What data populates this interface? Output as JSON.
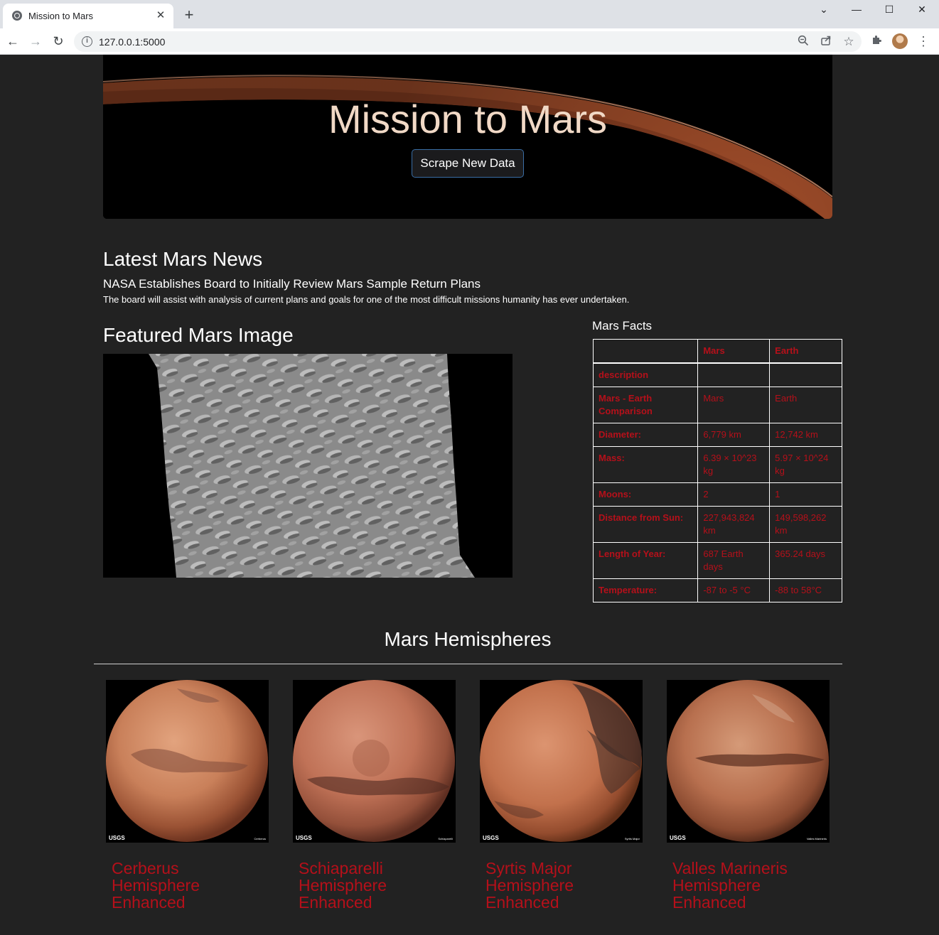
{
  "browser": {
    "tab_title": "Mission to Mars",
    "tab_close": "✕",
    "new_tab": "+",
    "url": "127.0.0.1:5000",
    "window_controls": {
      "tab_search": "⌄",
      "minimize": "—",
      "maximize": "☐",
      "close": "✕"
    },
    "icons": [
      "back-icon",
      "forward-icon",
      "reload-icon",
      "info-icon",
      "zoom-icon",
      "share-icon",
      "star-icon",
      "extensions-icon",
      "avatar",
      "menu-icon"
    ]
  },
  "jumbotron": {
    "title": "Mission to Mars",
    "button_label": "Scrape New Data"
  },
  "news": {
    "heading": "Latest Mars News",
    "title": "NASA Establishes Board to Initially Review Mars Sample Return Plans",
    "teaser": "The board will assist with analysis of current plans and goals for one of the most difficult missions humanity has ever undertaken."
  },
  "featured": {
    "heading": "Featured Mars Image"
  },
  "facts": {
    "heading": "Mars Facts",
    "columns": [
      "",
      "Mars",
      "Earth"
    ],
    "rows": [
      {
        "label": "description",
        "mars": "",
        "earth": ""
      },
      {
        "label": "Mars - Earth Comparison",
        "mars": "Mars",
        "earth": "Earth"
      },
      {
        "label": "Diameter:",
        "mars": "6,779 km",
        "earth": "12,742 km"
      },
      {
        "label": "Mass:",
        "mars": "6.39 × 10^23 kg",
        "earth": "5.97 × 10^24 kg"
      },
      {
        "label": "Moons:",
        "mars": "2",
        "earth": "1"
      },
      {
        "label": "Distance from Sun:",
        "mars": "227,943,824 km",
        "earth": "149,598,262 km"
      },
      {
        "label": "Length of Year:",
        "mars": "687 Earth days",
        "earth": "365.24 days"
      },
      {
        "label": "Temperature:",
        "mars": "-87 to -5 °C",
        "earth": "-88 to 58°C"
      }
    ]
  },
  "hemispheres": {
    "heading": "Mars Hemispheres",
    "items": [
      {
        "title": "Cerberus Hemisphere Enhanced",
        "logo": "USGS",
        "caption": "Cerberus"
      },
      {
        "title": "Schiaparelli Hemisphere Enhanced",
        "logo": "USGS",
        "caption": "Schiaparelli"
      },
      {
        "title": "Syrtis Major Hemisphere Enhanced",
        "logo": "USGS",
        "caption": "Syrtis Major"
      },
      {
        "title": "Valles Marineris Hemisphere Enhanced",
        "logo": "USGS",
        "caption": "Valles Marineris"
      }
    ]
  },
  "colors": {
    "page_background": "#222222",
    "accent_red": "#b5101a",
    "title_peach": "#f1d9c6",
    "button_border": "#3a6ea5"
  }
}
